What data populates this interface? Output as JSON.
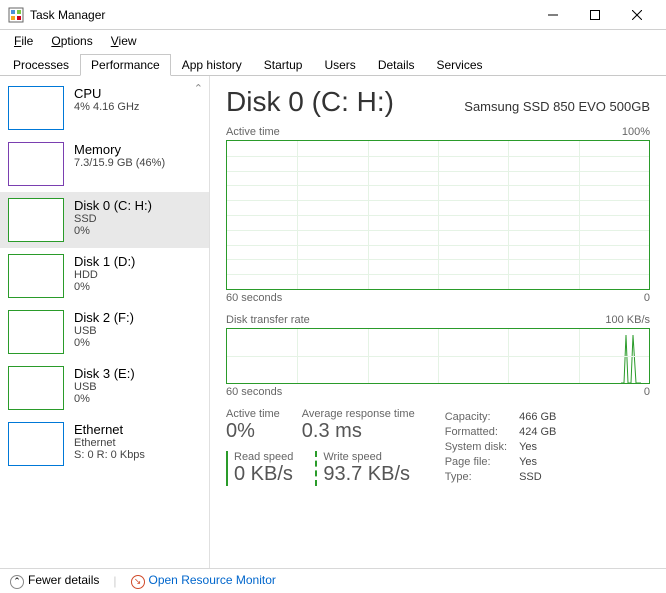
{
  "window": {
    "title": "Task Manager"
  },
  "menu": {
    "file": "File",
    "options": "Options",
    "view": "View"
  },
  "tabs": [
    "Processes",
    "Performance",
    "App history",
    "Startup",
    "Users",
    "Details",
    "Services"
  ],
  "activeTab": 1,
  "sidebar": [
    {
      "title": "CPU",
      "sub1": "4% 4.16 GHz",
      "sub2": "",
      "style": "blue"
    },
    {
      "title": "Memory",
      "sub1": "7.3/15.9 GB (46%)",
      "sub2": "",
      "style": "purple"
    },
    {
      "title": "Disk 0 (C: H:)",
      "sub1": "SSD",
      "sub2": "0%",
      "style": "green",
      "selected": true
    },
    {
      "title": "Disk 1 (D:)",
      "sub1": "HDD",
      "sub2": "0%",
      "style": "green"
    },
    {
      "title": "Disk 2 (F:)",
      "sub1": "USB",
      "sub2": "0%",
      "style": "green"
    },
    {
      "title": "Disk 3 (E:)",
      "sub1": "USB",
      "sub2": "0%",
      "style": "green"
    },
    {
      "title": "Ethernet",
      "sub1": "Ethernet",
      "sub2": "S: 0  R: 0 Kbps",
      "style": "blue"
    }
  ],
  "main": {
    "title": "Disk 0 (C: H:)",
    "subtitle": "Samsung SSD 850 EVO 500GB",
    "chart1": {
      "label": "Active time",
      "max": "100%",
      "xleft": "60 seconds",
      "xright": "0"
    },
    "chart2": {
      "label": "Disk transfer rate",
      "max": "100 KB/s",
      "xleft": "60 seconds",
      "xright": "0"
    },
    "stats": {
      "active_time": {
        "label": "Active time",
        "value": "0%"
      },
      "avg_response": {
        "label": "Average response time",
        "value": "0.3 ms"
      },
      "read": {
        "label": "Read speed",
        "value": "0 KB/s"
      },
      "write": {
        "label": "Write speed",
        "value": "93.7 KB/s"
      }
    },
    "kv": [
      [
        "Capacity:",
        "466 GB"
      ],
      [
        "Formatted:",
        "424 GB"
      ],
      [
        "System disk:",
        "Yes"
      ],
      [
        "Page file:",
        "Yes"
      ],
      [
        "Type:",
        "SSD"
      ]
    ]
  },
  "footer": {
    "fewer": "Fewer details",
    "resmon": "Open Resource Monitor"
  },
  "chart_data": {
    "type": "line",
    "title": "Disk 0 Active time / Transfer rate",
    "series": [
      {
        "name": "Active time %",
        "ylim": [
          0,
          100
        ],
        "values_note": "flat near 0 across 60s"
      },
      {
        "name": "Transfer rate KB/s",
        "ylim": [
          0,
          100
        ],
        "values_note": "near 0 with spikes to ~100 near t=0"
      }
    ],
    "xlabel": "seconds",
    "xrange": [
      60,
      0
    ]
  }
}
